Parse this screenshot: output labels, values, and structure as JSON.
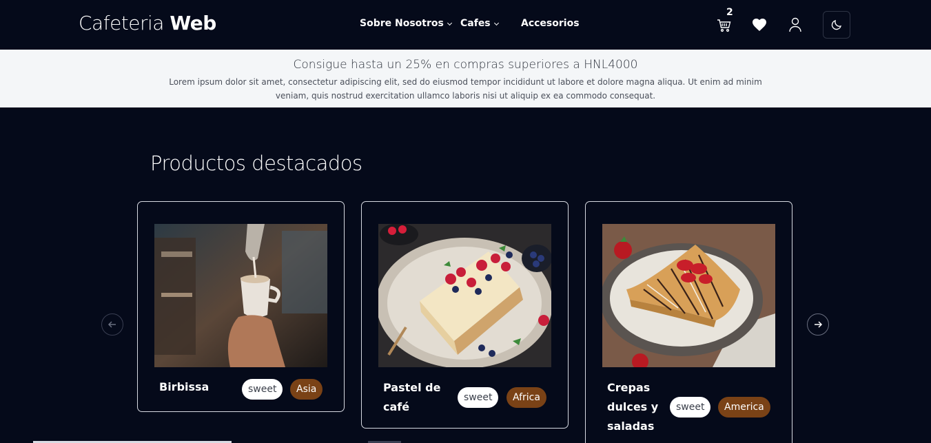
{
  "nav": {
    "logo_light": "Cafeteria ",
    "logo_bold": "Web",
    "links": [
      "Sobre Nosotros",
      "Cafes",
      "Accesorios"
    ],
    "cart_count": "2",
    "icons": {
      "cart": "cart-icon",
      "wishlist": "heart-icon",
      "account": "user-icon",
      "theme": "moon-icon"
    }
  },
  "promo": {
    "title": "Consigue hasta un 25% en compras superiores a HNL4000",
    "text": "Lorem ipsum dolor sit amet, consectetur adipiscing elit, sed do eiusmod tempor incididunt ut labore et dolore magna aliqua. Ut enim ad minim veniam, quis nostrud exercitation ullamco laboris nisi ut aliquip ex ea commodo consequat."
  },
  "products": {
    "title": "Productos destacados",
    "items": [
      {
        "name_lines": [
          "Birbissa"
        ],
        "tag": "sweet",
        "region": "Asia",
        "image": "coffee-pour-photo"
      },
      {
        "name_lines": [
          "Pastel de",
          "café"
        ],
        "tag": "sweet",
        "region": "Africa",
        "image": "cheesecake-photo"
      },
      {
        "name_lines": [
          "Crepas",
          "dulces y",
          "saladas"
        ],
        "tag": "sweet",
        "region": "America",
        "image": "crepe-photo"
      }
    ]
  },
  "colors": {
    "background": "#050a1a",
    "promo_bg": "#f4f6f8",
    "region_badge": "#7a4216",
    "sweet_badge": "#ffffff"
  }
}
